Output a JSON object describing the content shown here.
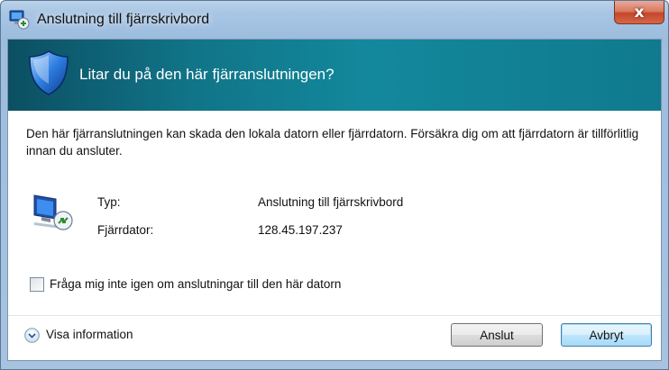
{
  "window": {
    "title": "Anslutning till fjärrskrivbord",
    "close_label": "x"
  },
  "banner": {
    "heading": "Litar du på den här fjärranslutningen?",
    "icon": "security-shield-icon"
  },
  "description": "Den här fjärranslutningen kan skada den lokala datorn eller fjärrdatorn. Försäkra dig om att fjärrdatorn är tillförlitlig innan du ansluter.",
  "connection": {
    "icon": "remote-desktop-computer-icon",
    "type_label": "Typ:",
    "type_value": "Anslutning till fjärrskrivbord",
    "remote_label": "Fjärrdator:",
    "remote_value": "128.45.197.237"
  },
  "dont_ask": {
    "label": "Fråga mig inte igen om anslutningar till den här datorn",
    "checked": false
  },
  "footer": {
    "details_label": "Visa information",
    "connect_label": "Anslut",
    "cancel_label": "Avbryt"
  },
  "colors": {
    "banner": "#117488",
    "close_button": "#c5472b",
    "default_button_border": "#3c7fb1"
  }
}
